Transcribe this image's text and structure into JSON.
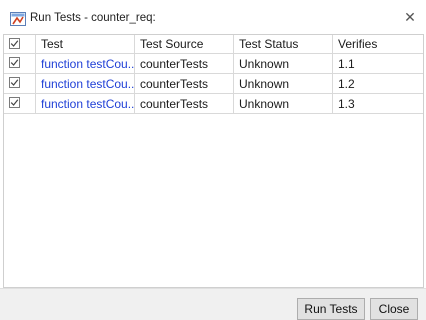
{
  "window": {
    "title": "Run Tests - counter_req:",
    "close_glyph": "✕"
  },
  "table": {
    "headers": [
      "Test",
      "Test Source",
      "Test Status",
      "Verifies"
    ],
    "rows": [
      {
        "test": "function testCou...",
        "source": "counterTests",
        "status": "Unknown",
        "verifies": "1.1",
        "checked": true
      },
      {
        "test": "function testCou...",
        "source": "counterTests",
        "status": "Unknown",
        "verifies": "1.2",
        "checked": true
      },
      {
        "test": "function testCou...",
        "source": "counterTests",
        "status": "Unknown",
        "verifies": "1.3",
        "checked": true
      }
    ]
  },
  "footer": {
    "run_label": "Run Tests",
    "close_label": "Close"
  },
  "colors": {
    "link": "#1f3fd6",
    "footer_bg": "#f0f0f0",
    "grid": "#d9d9d9"
  }
}
